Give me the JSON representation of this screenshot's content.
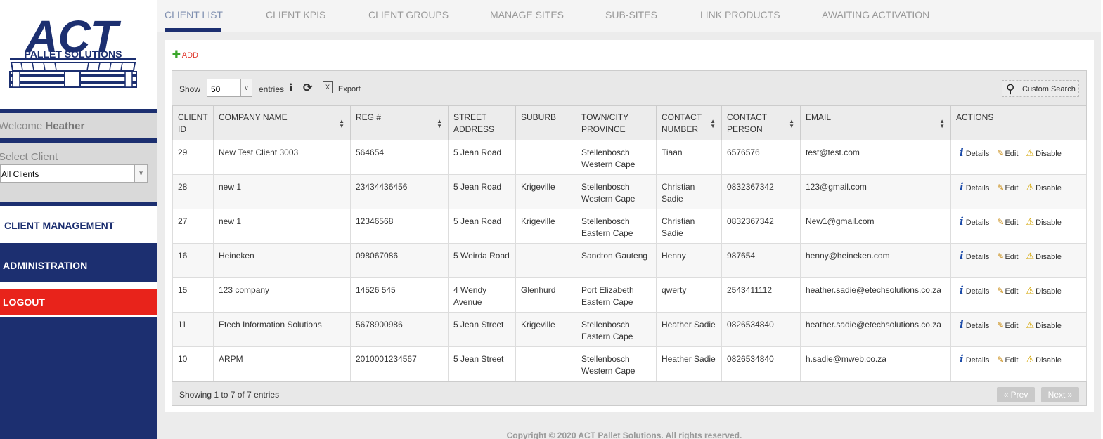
{
  "brand": {
    "logo_text": "ACT",
    "logo_sub": "PALLET SOLUTIONS"
  },
  "sidebar": {
    "welcome_prefix": "Welcome",
    "user_name": "Heather",
    "select_label": "Select Client",
    "select_value": "All Clients",
    "nav": {
      "client_management": "CLIENT MANAGEMENT",
      "administration": "ADMINISTRATION",
      "logout": "LOGOUT"
    }
  },
  "tabs": [
    "CLIENT LIST",
    "CLIENT KPIS",
    "CLIENT GROUPS",
    "MANAGE SITES",
    "SUB-SITES",
    "LINK PRODUCTS",
    "AWAITING ACTIVATION"
  ],
  "add_label": "ADD",
  "toolbar": {
    "show_label": "Show",
    "page_size": "50",
    "entries_label": "entries",
    "export_label": "Export",
    "custom_search": "Custom Search"
  },
  "table": {
    "columns": [
      "CLIENT ID",
      "COMPANY NAME",
      "REG #",
      "STREET ADDRESS",
      "SUBURB",
      "TOWN/CITY PROVINCE",
      "CONTACT NUMBER",
      "CONTACT PERSON",
      "EMAIL",
      "ACTIONS"
    ],
    "rows": [
      {
        "id": "29",
        "company": "New Test Client 3003",
        "reg": "564654",
        "street": "5 Jean Road",
        "suburb": "",
        "town": "Stellenbosch Western Cape",
        "contact_number": "Tiaan",
        "contact_person": "6576576",
        "email": "test@test.com"
      },
      {
        "id": "28",
        "company": "new 1",
        "reg": "23434436456",
        "street": "5 Jean Road",
        "suburb": "Krigeville",
        "town": "Stellenbosch Western Cape",
        "contact_number": "Christian Sadie",
        "contact_person": "0832367342",
        "email": "123@gmail.com"
      },
      {
        "id": "27",
        "company": "new 1",
        "reg": "12346568",
        "street": "5 Jean Road",
        "suburb": "Krigeville",
        "town": "Stellenbosch Eastern Cape",
        "contact_number": "Christian Sadie",
        "contact_person": "0832367342",
        "email": "New1@gmail.com"
      },
      {
        "id": "16",
        "company": "Heineken",
        "reg": "098067086",
        "street": "5 Weirda Road",
        "suburb": "",
        "town": "Sandton Gauteng",
        "contact_number": "Henny",
        "contact_person": "987654",
        "email": "henny@heineken.com"
      },
      {
        "id": "15",
        "company": "123 company",
        "reg": "14526 545",
        "street": "4 Wendy Avenue",
        "suburb": "Glenhurd",
        "town": "Port Elizabeth Eastern Cape",
        "contact_number": "qwerty",
        "contact_person": "2543411112",
        "email": "heather.sadie@etechsolutions.co.za"
      },
      {
        "id": "11",
        "company": "Etech Information Solutions",
        "reg": "5678900986",
        "street": "5 Jean Street",
        "suburb": "Krigeville",
        "town": "Stellenbosch Eastern Cape",
        "contact_number": "Heather Sadie",
        "contact_person": "0826534840",
        "email": "heather.sadie@etechsolutions.co.za"
      },
      {
        "id": "10",
        "company": "ARPM",
        "reg": "2010001234567",
        "street": "5 Jean Street",
        "suburb": "",
        "town": "Stellenbosch Western Cape",
        "contact_number": "Heather Sadie",
        "contact_person": "0826534840",
        "email": "h.sadie@mweb.co.za"
      }
    ],
    "actions": {
      "details": "Details",
      "edit": "Edit",
      "disable": "Disable"
    }
  },
  "pagination": {
    "summary": "Showing 1 to 7 of 7 entries",
    "prev": "« Prev",
    "next": "Next »"
  },
  "copyright": "Copyright © 2020 ACT Pallet Solutions. All rights reserved.",
  "colors": {
    "navy": "#1c2f70",
    "logout_red": "#e8231b",
    "add_green": "#3aa62a"
  }
}
